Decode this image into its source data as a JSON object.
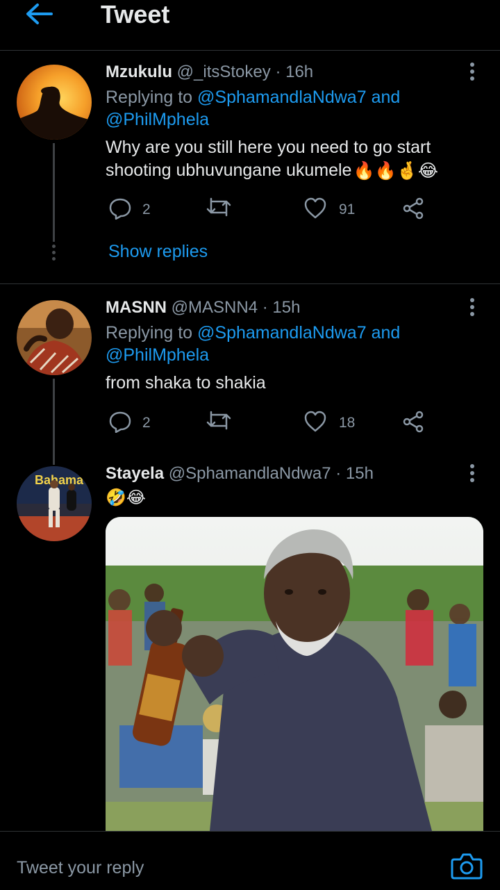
{
  "header": {
    "title": "Tweet"
  },
  "tweets": [
    {
      "name": "Mzukulu",
      "handle": "@_itsStokey",
      "time": "16h",
      "replying_prefix": "Replying to",
      "replying_to_1": "@SphamandlaNdwa7",
      "replying_and": "and",
      "replying_to_2": "@PhilMphela",
      "text_line1": "Why are you still here you need to go start",
      "text_line2": "shooting ubhuvungane ukumele",
      "emojis": "🔥🔥🤞😂",
      "replies": "2",
      "likes": "91",
      "show_replies": "Show replies"
    },
    {
      "name": "MASNN",
      "handle": "@MASNN4",
      "time": "15h",
      "replying_prefix": "Replying to",
      "replying_to_1": "@SphamandlaNdwa7",
      "replying_and": "and",
      "replying_to_2": "@PhilMphela",
      "text_line1": "from shaka to shakia",
      "replies": "2",
      "likes": "18"
    },
    {
      "name": "Stayela",
      "handle": "@SphamandlaNdwa7",
      "time": "15h",
      "emojis": "🤣😂",
      "avatar_text": "Bahama"
    }
  ],
  "composer": {
    "placeholder": "Tweet your reply"
  },
  "colors": {
    "accent": "#1d9bf0",
    "background": "#000000",
    "muted": "#8b98a5"
  }
}
